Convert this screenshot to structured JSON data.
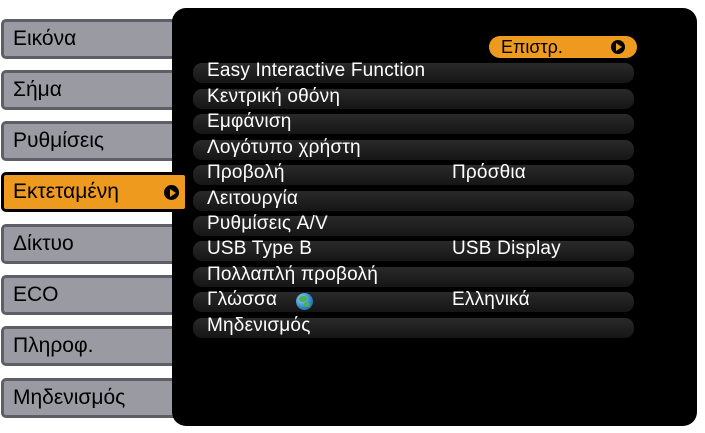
{
  "tabs": [
    {
      "label": "Εικόνα"
    },
    {
      "label": "Σήμα"
    },
    {
      "label": "Ρυθμίσεις"
    },
    {
      "label": "Εκτεταμένη",
      "active": true
    },
    {
      "label": "Δίκτυο"
    },
    {
      "label": "ECO"
    },
    {
      "label": "Πληροφ."
    },
    {
      "label": "Μηδενισμός"
    }
  ],
  "back_button": {
    "label": "Επιστρ."
  },
  "menu": [
    {
      "label": "Easy Interactive Function",
      "value": ""
    },
    {
      "label": "Κεντρική οθόνη",
      "value": ""
    },
    {
      "label": "Εμφάνιση",
      "value": ""
    },
    {
      "label": "Λογότυπο χρήστη",
      "value": ""
    },
    {
      "label": "Προβολή",
      "value": "Πρόσθια"
    },
    {
      "label": "Λειτουργία",
      "value": ""
    },
    {
      "label": "Ρυθμίσεις A/V",
      "value": ""
    },
    {
      "label": "USB Type B",
      "value": "USB Display"
    },
    {
      "label": "Πολλαπλή προβολή",
      "value": ""
    },
    {
      "label": "Γλώσσα",
      "value": "Ελληνικά",
      "icon": "globe-icon"
    },
    {
      "label": "Μηδενισμός",
      "value": ""
    }
  ],
  "colors": {
    "accent": "#ee9a1e",
    "panel": "#000000",
    "tab": "#9a9aa2",
    "tab_border": "#5e5e66"
  }
}
